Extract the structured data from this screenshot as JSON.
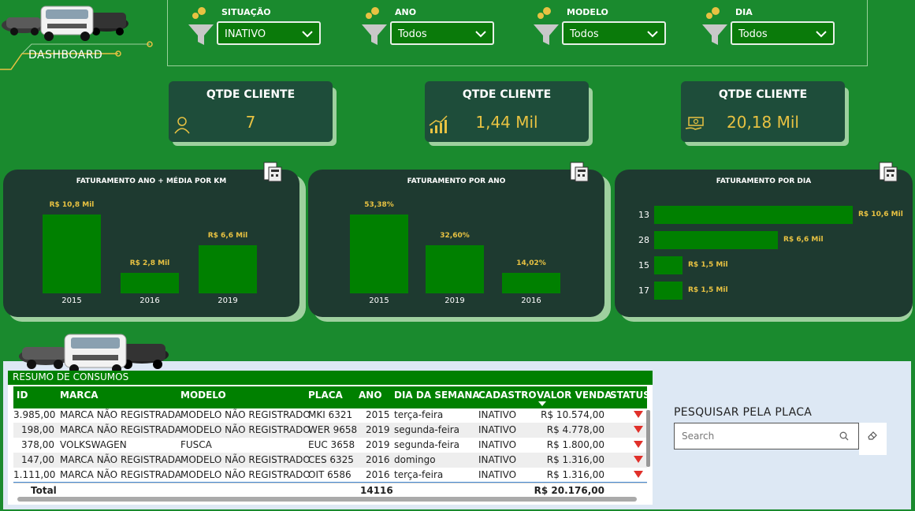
{
  "header": {
    "dashboard_label": "DASHBOARD"
  },
  "filters": [
    {
      "label": "SITUAÇÃO",
      "value": "INATIVO"
    },
    {
      "label": "ANO",
      "value": "Todos"
    },
    {
      "label": "MODELO",
      "value": "Todos"
    },
    {
      "label": "DIA",
      "value": "Todos"
    }
  ],
  "kpis": [
    {
      "title": "QTDE CLIENTE",
      "value": "7",
      "icon": "customer-icon"
    },
    {
      "title": "QTDE CLIENTE",
      "value": "1,44 Mil",
      "icon": "growth-chart-icon"
    },
    {
      "title": "QTDE CLIENTE",
      "value": "20,18 Mil",
      "icon": "money-hand-icon"
    }
  ],
  "chart_data": [
    {
      "type": "bar",
      "title": "FATURAMENTO ANO + MÉDIA POR KM",
      "categories": [
        "2015",
        "2016",
        "2019"
      ],
      "values": [
        10.8,
        2.8,
        6.6
      ],
      "data_labels": [
        "R$ 10,8 Mil",
        "R$ 2,8 Mil",
        "R$ 6,6 Mil"
      ],
      "ylim": [
        0,
        10.8
      ]
    },
    {
      "type": "bar",
      "title": "FATURAMENTO POR ANO",
      "categories": [
        "2015",
        "2019",
        "2016"
      ],
      "values": [
        53.38,
        32.6,
        14.02
      ],
      "data_labels": [
        "53,38%",
        "32,60%",
        "14,02%"
      ],
      "ylim": [
        0,
        53.38
      ]
    },
    {
      "type": "bar",
      "orientation": "horizontal",
      "title": "FATURAMENTO POR DIA",
      "categories": [
        "13",
        "28",
        "15",
        "17"
      ],
      "values": [
        10.6,
        6.6,
        1.5,
        1.5
      ],
      "data_labels": [
        "R$ 10,6 Mil",
        "R$ 6,6 Mil",
        "R$ 1,5 Mil",
        "R$ 1,5 Mil"
      ],
      "ylim": [
        0,
        10.6
      ]
    }
  ],
  "table": {
    "title": "RESUMO DE CONSUMOS",
    "columns": [
      "ID",
      "MARCA",
      "MODELO",
      "PLACA",
      "ANO",
      "DIA DA SEMANA",
      "CADASTRO",
      "VALOR VENDA",
      "STATUS"
    ],
    "rows": [
      [
        "3.985,00",
        "MARCA NÃO REGISTRADA",
        "MODELO NÃO REGISTRADO",
        "MKI 6321",
        "2015",
        "terça-feira",
        "INATIVO",
        "R$ 10.574,00"
      ],
      [
        "198,00",
        "MARCA NÃO REGISTRADA",
        "MODELO NÃO REGISTRADO",
        "WER 9658",
        "2019",
        "segunda-feira",
        "INATIVO",
        "R$ 4.778,00"
      ],
      [
        "378,00",
        "VOLKSWAGEN",
        "FUSCA",
        "EUC 3658",
        "2019",
        "segunda-feira",
        "INATIVO",
        "R$ 1.800,00"
      ],
      [
        "147,00",
        "MARCA NÃO REGISTRADA",
        "MODELO NÃO REGISTRADO",
        "CES 6325",
        "2016",
        "domingo",
        "INATIVO",
        "R$ 1.316,00"
      ],
      [
        "1.111,00",
        "MARCA NÃO REGISTRADA",
        "MODELO NÃO REGISTRADO",
        "OIT 6586",
        "2016",
        "terça-feira",
        "INATIVO",
        "R$ 1.316,00"
      ]
    ],
    "total_label": "Total",
    "total_ano": "14116",
    "total_valor": "R$ 20.176,00",
    "status_color": "#e0302a"
  },
  "search": {
    "label": "PESQUISAR PELA PLACA",
    "placeholder": "Search"
  },
  "colors": {
    "background": "#1a8a2e",
    "bar": "#008000",
    "accent": "#e8c242",
    "panel": "#1e3a30"
  }
}
